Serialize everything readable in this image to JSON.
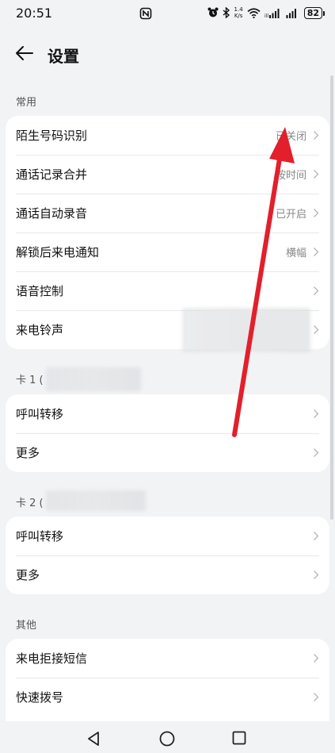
{
  "status_bar": {
    "time": "20:51",
    "speed_value": "1.4",
    "speed_unit": "K/s",
    "battery": "82"
  },
  "header": {
    "title": "设置"
  },
  "sections": {
    "common": {
      "label": "常用",
      "rows": [
        {
          "label": "陌生号码识别",
          "value": "已关闭"
        },
        {
          "label": "通话记录合并",
          "value": "按时间"
        },
        {
          "label": "通话自动录音",
          "value": "已开启"
        },
        {
          "label": "解锁后来电通知",
          "value": "横幅"
        },
        {
          "label": "语音控制",
          "value": ""
        },
        {
          "label": "来电铃声",
          "value": ""
        }
      ]
    },
    "card1": {
      "label": "卡 1 (",
      "rows": [
        {
          "label": "呼叫转移"
        },
        {
          "label": "更多"
        }
      ]
    },
    "card2": {
      "label": "卡 2 (",
      "rows": [
        {
          "label": "呼叫转移"
        },
        {
          "label": "更多"
        }
      ]
    },
    "other": {
      "label": "其他",
      "rows": [
        {
          "label": "来电拒接短信"
        },
        {
          "label": "快速拨号"
        }
      ]
    }
  },
  "colors": {
    "annotation_arrow": "#e2202c",
    "background": "#f1f3f5",
    "card": "#ffffff"
  }
}
